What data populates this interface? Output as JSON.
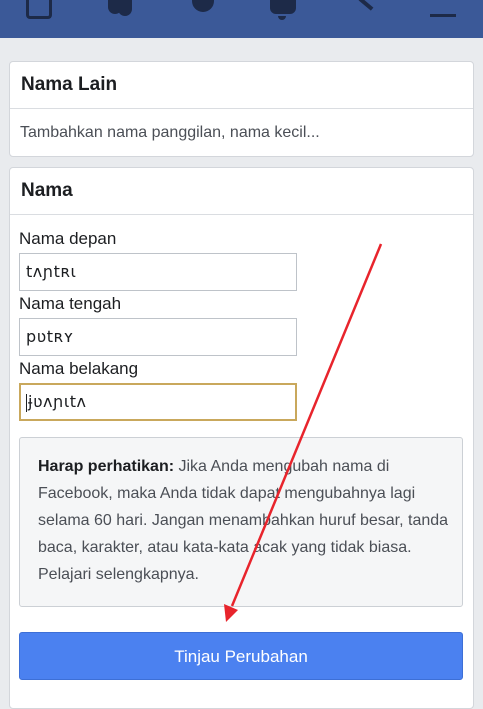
{
  "topbar": {
    "icons": [
      "home-icon",
      "friends-icon",
      "messenger-icon",
      "notifications-icon",
      "search-icon",
      "menu-icon"
    ],
    "background_color": "#3b5998"
  },
  "alias_section": {
    "title": "Nama Lain",
    "prompt": "Tambahkan nama panggilan, nama kecil..."
  },
  "name_section": {
    "title": "Nama",
    "first_name_label": "Nama depan",
    "first_name_value": "tʌɲtʀι",
    "middle_name_label": "Nama tengah",
    "middle_name_value": "pʋtʀʏ",
    "last_name_label": "Nama belakang",
    "last_name_value": "ɉʋʌɲιtʌ",
    "notice_bold": "Harap perhatikan:",
    "notice_text": " Jika Anda mengubah nama di Facebook, maka Anda tidak dapat mengubahnya lagi selama 60 hari. Jangan menambahkan huruf besar, tanda baca, karakter, atau kata-kata acak yang tidak biasa. ",
    "notice_link": "Pelajari selengkapnya.",
    "review_button": "Tinjau Perubahan",
    "button_color": "#4b81f0"
  },
  "annotation": {
    "arrow_color": "#e8242c"
  }
}
